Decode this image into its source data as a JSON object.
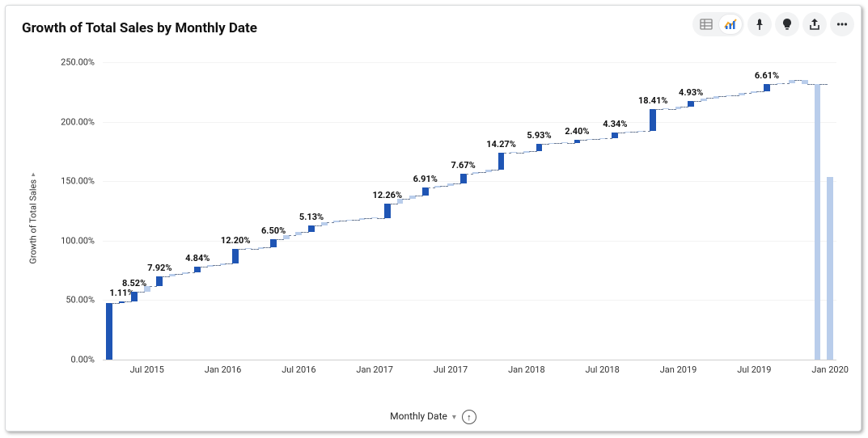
{
  "title": "Growth of Total Sales by Monthly Date",
  "toolbar": {
    "table_view": "table-icon",
    "chart_view": "chart-icon",
    "pin": "pin-icon",
    "insight": "bulb-icon",
    "share": "share-icon",
    "more": "more-icon"
  },
  "axes": {
    "y_title": "Growth of Total Sales",
    "x_title": "Monthly Date"
  },
  "colors": {
    "bar_solid": "#1f55b4",
    "bar_light": "#b9cdeb",
    "grid": "#f3f3f3",
    "baseline": "#cfcfcf",
    "connector": "#6e7d96"
  },
  "chart_data": {
    "type": "bar",
    "subtype": "waterfall",
    "ylabel": "Growth of Total Sales",
    "xlabel": "Monthly Date",
    "ylim": [
      0,
      250
    ],
    "y_format": "{v:.2f}%",
    "y_ticks": [
      0,
      50,
      100,
      150,
      200,
      250
    ],
    "x_tick_labels": [
      "Jul 2015",
      "Jan 2016",
      "Jul 2016",
      "Jan 2017",
      "Jul 2017",
      "Jan 2018",
      "Jul 2018",
      "Jan 2019",
      "Jul 2019",
      "Jan 2020"
    ],
    "x_tick_indices": [
      3,
      9,
      15,
      21,
      27,
      33,
      39,
      45,
      51,
      57
    ],
    "data_labels_every_third_starting_at": 1,
    "series": [
      {
        "idx": 0,
        "base": 0.0,
        "delta": 47.5,
        "label": null
      },
      {
        "idx": 1,
        "base": 47.5,
        "delta": 1.11,
        "label": "1.11%"
      },
      {
        "idx": 2,
        "base": 48.61,
        "delta": 8.52,
        "label": "8.52%"
      },
      {
        "idx": 3,
        "base": 57.13,
        "delta": 4.83,
        "label": null
      },
      {
        "idx": 4,
        "base": 61.96,
        "delta": 7.92,
        "label": "7.92%"
      },
      {
        "idx": 5,
        "base": 69.88,
        "delta": 2.2,
        "label": null
      },
      {
        "idx": 6,
        "base": 72.08,
        "delta": 1.3,
        "label": null
      },
      {
        "idx": 7,
        "base": 73.38,
        "delta": 4.84,
        "label": "4.84%"
      },
      {
        "idx": 8,
        "base": 78.22,
        "delta": 1.6,
        "label": null
      },
      {
        "idx": 9,
        "base": 79.82,
        "delta": 0.8,
        "label": null
      },
      {
        "idx": 10,
        "base": 80.62,
        "delta": 12.2,
        "label": "12.20%"
      },
      {
        "idx": 11,
        "base": 92.82,
        "delta": 0.45,
        "label": null
      },
      {
        "idx": 12,
        "base": 93.27,
        "delta": 1.3,
        "label": null
      },
      {
        "idx": 13,
        "base": 94.57,
        "delta": 6.5,
        "label": "6.50%"
      },
      {
        "idx": 14,
        "base": 101.07,
        "delta": 3.4,
        "label": null
      },
      {
        "idx": 15,
        "base": 104.47,
        "delta": 3.2,
        "label": null
      },
      {
        "idx": 16,
        "base": 107.67,
        "delta": 5.13,
        "label": "5.13%"
      },
      {
        "idx": 17,
        "base": 112.8,
        "delta": 2.6,
        "label": null
      },
      {
        "idx": 18,
        "base": 115.4,
        "delta": 1.5,
        "label": null
      },
      {
        "idx": 19,
        "base": 116.9,
        "delta": 0.7,
        "label": null
      },
      {
        "idx": 20,
        "base": 117.6,
        "delta": 1.0,
        "label": null
      },
      {
        "idx": 21,
        "base": 118.6,
        "delta": 0.3,
        "label": null
      },
      {
        "idx": 22,
        "base": 118.9,
        "delta": 12.26,
        "label": "12.26%"
      },
      {
        "idx": 23,
        "base": 131.16,
        "delta": 4.2,
        "label": null
      },
      {
        "idx": 24,
        "base": 135.36,
        "delta": 2.3,
        "label": null
      },
      {
        "idx": 25,
        "base": 137.66,
        "delta": 6.91,
        "label": "6.91%"
      },
      {
        "idx": 26,
        "base": 144.57,
        "delta": 1.7,
        "label": null
      },
      {
        "idx": 27,
        "base": 146.27,
        "delta": 2.1,
        "label": null
      },
      {
        "idx": 28,
        "base": 148.37,
        "delta": 7.67,
        "label": "7.67%"
      },
      {
        "idx": 29,
        "base": 156.04,
        "delta": 1.4,
        "label": null
      },
      {
        "idx": 30,
        "base": 157.44,
        "delta": 2.2,
        "label": null
      },
      {
        "idx": 31,
        "base": 159.64,
        "delta": 14.27,
        "label": "14.27%"
      },
      {
        "idx": 32,
        "base": 173.91,
        "delta": 0.3,
        "label": null
      },
      {
        "idx": 33,
        "base": 174.21,
        "delta": 1.3,
        "label": null
      },
      {
        "idx": 34,
        "base": 175.51,
        "delta": 5.93,
        "label": "5.93%"
      },
      {
        "idx": 35,
        "base": 181.44,
        "delta": 0.6,
        "label": null
      },
      {
        "idx": 36,
        "base": 182.04,
        "delta": 0.3,
        "label": null
      },
      {
        "idx": 37,
        "base": 182.34,
        "delta": 2.4,
        "label": "2.40%"
      },
      {
        "idx": 38,
        "base": 184.74,
        "delta": 0.45,
        "label": null
      },
      {
        "idx": 39,
        "base": 185.19,
        "delta": 1.1,
        "label": null
      },
      {
        "idx": 40,
        "base": 186.29,
        "delta": 4.34,
        "label": "4.34%"
      },
      {
        "idx": 41,
        "base": 190.63,
        "delta": 1.0,
        "label": null
      },
      {
        "idx": 42,
        "base": 191.63,
        "delta": 0.3,
        "label": null
      },
      {
        "idx": 43,
        "base": 191.93,
        "delta": 18.41,
        "label": "18.41%"
      },
      {
        "idx": 44,
        "base": 210.34,
        "delta": 0.5,
        "label": null
      },
      {
        "idx": 45,
        "base": 210.84,
        "delta": 1.7,
        "label": null
      },
      {
        "idx": 46,
        "base": 212.54,
        "delta": 4.93,
        "label": "4.93%"
      },
      {
        "idx": 47,
        "base": 217.47,
        "delta": 2.3,
        "label": null
      },
      {
        "idx": 48,
        "base": 219.77,
        "delta": 1.5,
        "label": null
      },
      {
        "idx": 49,
        "base": 221.27,
        "delta": 0.6,
        "label": null
      },
      {
        "idx": 50,
        "base": 221.87,
        "delta": 2.6,
        "label": null
      },
      {
        "idx": 51,
        "base": 224.47,
        "delta": 0.8,
        "label": null
      },
      {
        "idx": 52,
        "base": 225.27,
        "delta": 6.61,
        "label": "6.61%"
      },
      {
        "idx": 53,
        "base": 231.88,
        "delta": 0.4,
        "label": null
      },
      {
        "idx": 54,
        "base": 232.28,
        "delta": 3.0,
        "label": null
      },
      {
        "idx": 55,
        "base": 235.28,
        "delta": -3.5,
        "label": null
      },
      {
        "idx": 56,
        "base": 0.0,
        "delta": 231.78,
        "label": null,
        "is_total": true
      },
      {
        "idx": 57,
        "base": 0.0,
        "delta": 153.5,
        "label": null,
        "is_total": true
      }
    ]
  }
}
